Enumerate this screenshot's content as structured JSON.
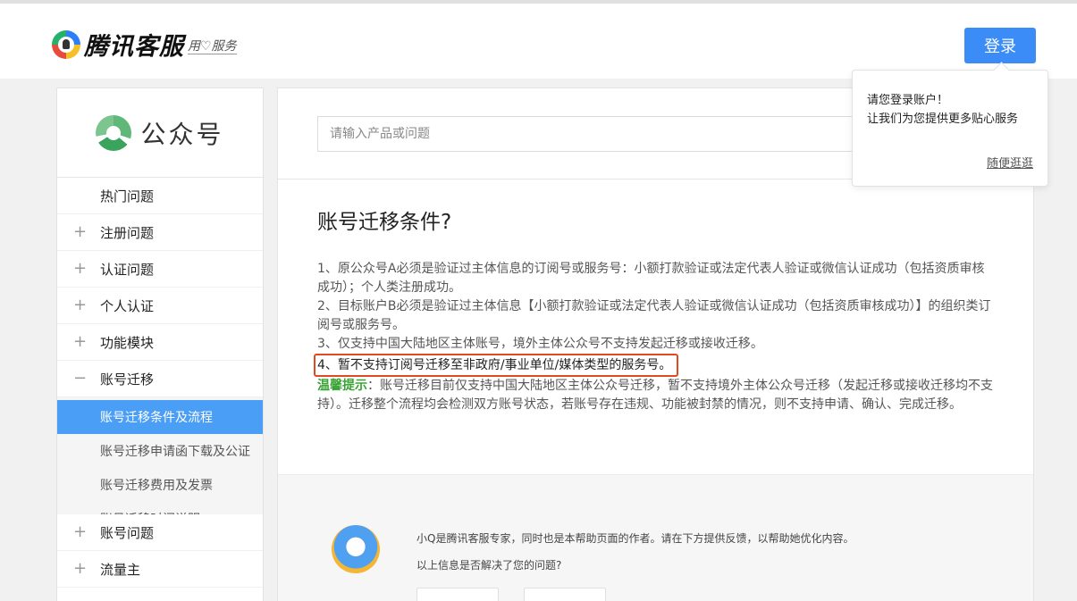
{
  "header": {
    "logo_text": "腾讯客服",
    "slogan": "用♡服务",
    "login_label": "登录"
  },
  "sidebar": {
    "brand_label": "公众号",
    "items": [
      {
        "icon": "",
        "label": "热门问题"
      },
      {
        "icon": "+",
        "label": "注册问题"
      },
      {
        "icon": "+",
        "label": "认证问题"
      },
      {
        "icon": "+",
        "label": "个人认证"
      },
      {
        "icon": "+",
        "label": "功能模块"
      },
      {
        "icon": "−",
        "label": "账号迁移"
      }
    ],
    "sub_items": [
      {
        "label": "账号迁移条件及流程",
        "active": true
      },
      {
        "label": "账号迁移申请函下载及公证",
        "active": false
      },
      {
        "label": "账号迁移费用及发票",
        "active": false
      },
      {
        "label": "账号迁移时间说明",
        "active": false
      }
    ],
    "items_after": [
      {
        "icon": "+",
        "label": "账号问题"
      },
      {
        "icon": "+",
        "label": "流量主"
      }
    ]
  },
  "search": {
    "placeholder": "请输入产品或问题"
  },
  "article": {
    "title": "账号迁移条件?",
    "p1": "1、原公众号A必须是验证过主体信息的订阅号或服务号：小额打款验证或法定代表人验证或微信认证成功（包括资质审核成功）；个人类注册成功。",
    "p2": "2、目标账户B必须是验证过主体信息【小额打款验证或法定代表人验证或微信认证成功（包括资质审核成功）】的组织类订阅号或服务号。",
    "p3": "3、仅支持中国大陆地区主体账号，境外主体公众号不支持发起迁移或接收迁移。",
    "p4": "4、暂不支持订阅号迁移至非政府/事业单位/媒体类型的服务号。",
    "tip_label": "温馨提示",
    "tip_text": "：账号迁移目前仅支持中国大陆地区主体公众号迁移，暂不支持境外主体公众号迁移（发起迁移或接收迁移均不支持）。迁移整个流程均会检测双方账号状态，若账号存在违规、功能被封禁的情况，则不支持申请、确认、完成迁移。"
  },
  "feedback": {
    "intro": "小Q是腾讯客服专家，同时也是本帮助页面的作者。请在下方提供反馈，以帮助她优化内容。",
    "question": "以上信息是否解决了您的问题?"
  },
  "popup": {
    "line1": "请您登录账户！",
    "line2": "让我们为您提供更多贴心服务",
    "link": "随便逛逛"
  }
}
